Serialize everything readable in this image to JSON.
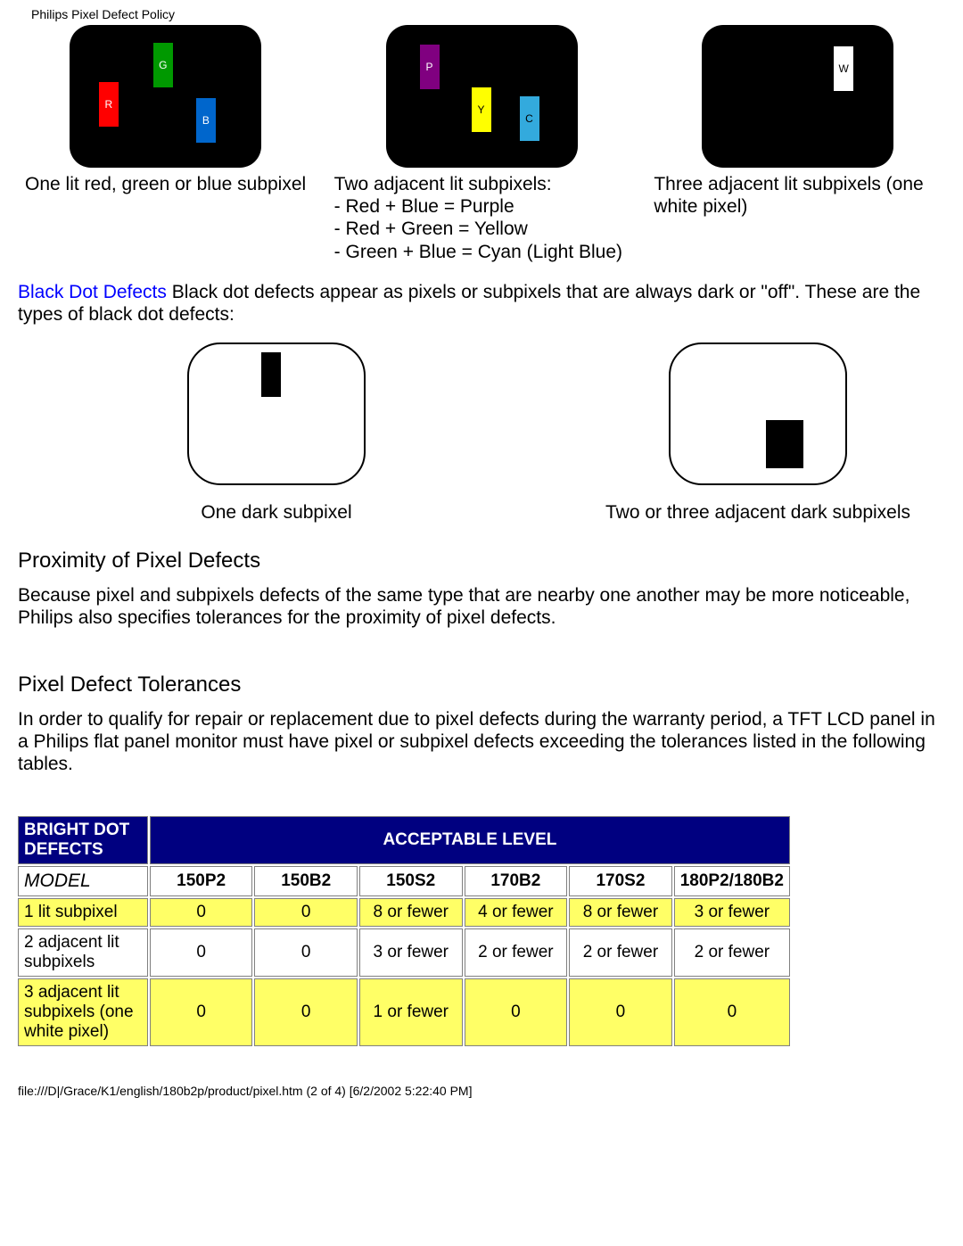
{
  "headerTitle": "Philips Pixel Defect Policy",
  "brightRow": {
    "col1": {
      "sub1": "R",
      "sub2": "G",
      "sub3": "B",
      "caption": "One lit red, green or blue subpixel"
    },
    "col2": {
      "sub1": "P",
      "sub2": "Y",
      "sub3": "C",
      "line1": "Two adjacent lit subpixels:",
      "line2": "- Red + Blue = Purple",
      "line3": "- Red + Green = Yellow",
      "line4": "- Green + Blue = Cyan (Light Blue)"
    },
    "col3": {
      "sub1": "W",
      "caption": "Three adjacent lit subpixels (one white pixel)"
    }
  },
  "blackDot": {
    "lead": "Black Dot Defects",
    "text": " Black dot defects appear as pixels or subpixels that are always dark or \"off\". These are the types of black dot defects:",
    "cap1": "One dark subpixel",
    "cap2": "Two or three adjacent dark subpixels"
  },
  "proximity": {
    "heading": "Proximity of Pixel Defects",
    "text": "Because pixel and subpixels defects of the same type that are nearby one another may be more noticeable, Philips also specifies tolerances for the proximity of pixel defects."
  },
  "tolerances": {
    "heading": "Pixel Defect Tolerances",
    "text": "In order to qualify for repair or replacement due to pixel defects during the warranty period, a TFT LCD panel in a Philips flat panel monitor must have pixel or subpixel defects exceeding the tolerances listed in the following tables."
  },
  "table": {
    "h1": "BRIGHT DOT DEFECTS",
    "h2": "ACCEPTABLE LEVEL",
    "modelLabel": "MODEL",
    "models": {
      "m1": "150P2",
      "m2": "150B2",
      "m3": "150S2",
      "m4": "170B2",
      "m5": "170S2",
      "m6": "180P2/180B2"
    },
    "r1": {
      "label": "1 lit subpixel",
      "c1": "0",
      "c2": "0",
      "c3": "8 or fewer",
      "c4": "4 or fewer",
      "c5": "8 or fewer",
      "c6": "3 or fewer"
    },
    "r2": {
      "label": "2 adjacent lit subpixels",
      "c1": "0",
      "c2": "0",
      "c3": "3 or fewer",
      "c4": "2 or fewer",
      "c5": "2 or fewer",
      "c6": "2 or fewer"
    },
    "r3": {
      "label": "3 adjacent lit subpixels (one white pixel)",
      "c1": "0",
      "c2": "0",
      "c3": "1 or fewer",
      "c4": "0",
      "c5": "0",
      "c6": "0"
    }
  },
  "footer": "file:///D|/Grace/K1/english/180b2p/product/pixel.htm (2 of 4) [6/2/2002 5:22:40 PM]"
}
